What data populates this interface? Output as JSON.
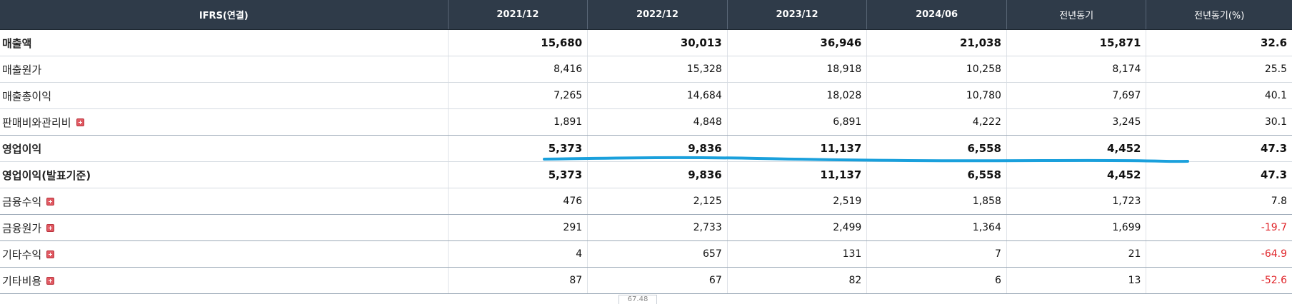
{
  "header": {
    "label": "IFRS(연결)",
    "columns": [
      "2021/12",
      "2022/12",
      "2023/12",
      "2024/06",
      "전년동기",
      "전년동기(%)"
    ]
  },
  "rows": [
    {
      "label": "매출액",
      "values": [
        "15,680",
        "30,013",
        "36,946",
        "21,038",
        "15,871",
        "32.6"
      ]
    },
    {
      "label": "매출원가",
      "values": [
        "8,416",
        "15,328",
        "18,918",
        "10,258",
        "8,174",
        "25.5"
      ]
    },
    {
      "label": "매출총이익",
      "values": [
        "7,265",
        "14,684",
        "18,028",
        "10,780",
        "7,697",
        "40.1"
      ]
    },
    {
      "label": "판매비와관리비",
      "values": [
        "1,891",
        "4,848",
        "6,891",
        "4,222",
        "3,245",
        "30.1"
      ]
    },
    {
      "label": "영업이익",
      "values": [
        "5,373",
        "9,836",
        "11,137",
        "6,558",
        "4,452",
        "47.3"
      ]
    },
    {
      "label": "영업이익(발표기준)",
      "values": [
        "5,373",
        "9,836",
        "11,137",
        "6,558",
        "4,452",
        "47.3"
      ]
    },
    {
      "label": "금융수익",
      "values": [
        "476",
        "2,125",
        "2,519",
        "1,858",
        "1,723",
        "7.8"
      ]
    },
    {
      "label": "금융원가",
      "values": [
        "291",
        "2,733",
        "2,499",
        "1,364",
        "1,699",
        "-19.7"
      ]
    },
    {
      "label": "기타수익",
      "values": [
        "4",
        "657",
        "131",
        "7",
        "21",
        "-64.9"
      ]
    },
    {
      "label": "기타비용",
      "values": [
        "87",
        "67",
        "82",
        "6",
        "13",
        "-52.6"
      ]
    }
  ],
  "colors": {
    "header_bg": "#2f3b49",
    "negative": "#e0262b",
    "annotation_line": "#1aa0dc",
    "expand_icon": "#e05a63"
  },
  "bottom_stub_text": "67.48"
}
